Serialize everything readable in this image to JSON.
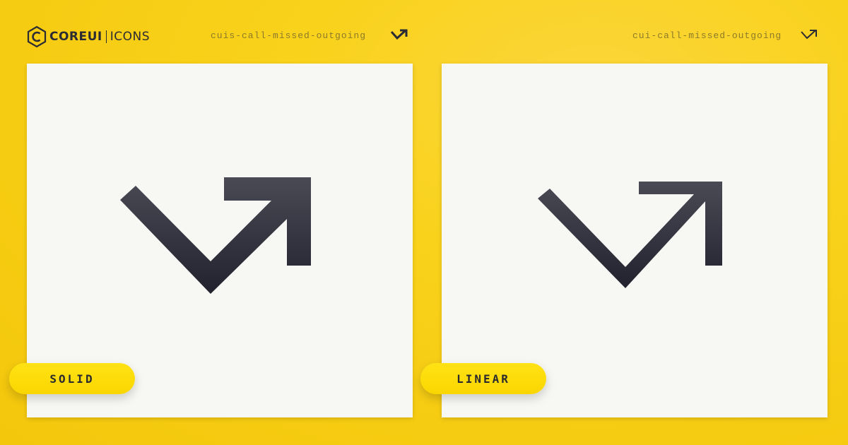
{
  "brand": {
    "core": "COREUI",
    "icons": "ICONS"
  },
  "panels": [
    {
      "icon_name": "cuis-call-missed-outgoing",
      "style_label": "SOLID",
      "icon": "call-missed-outgoing-icon"
    },
    {
      "icon_name": "cui-call-missed-outgoing",
      "style_label": "LINEAR",
      "icon": "call-missed-outgoing-icon"
    }
  ],
  "colors": {
    "background": "#f9d21c",
    "card": "#f7f7f3",
    "icon": "#2b2b38",
    "pill": "#fcdb00"
  }
}
